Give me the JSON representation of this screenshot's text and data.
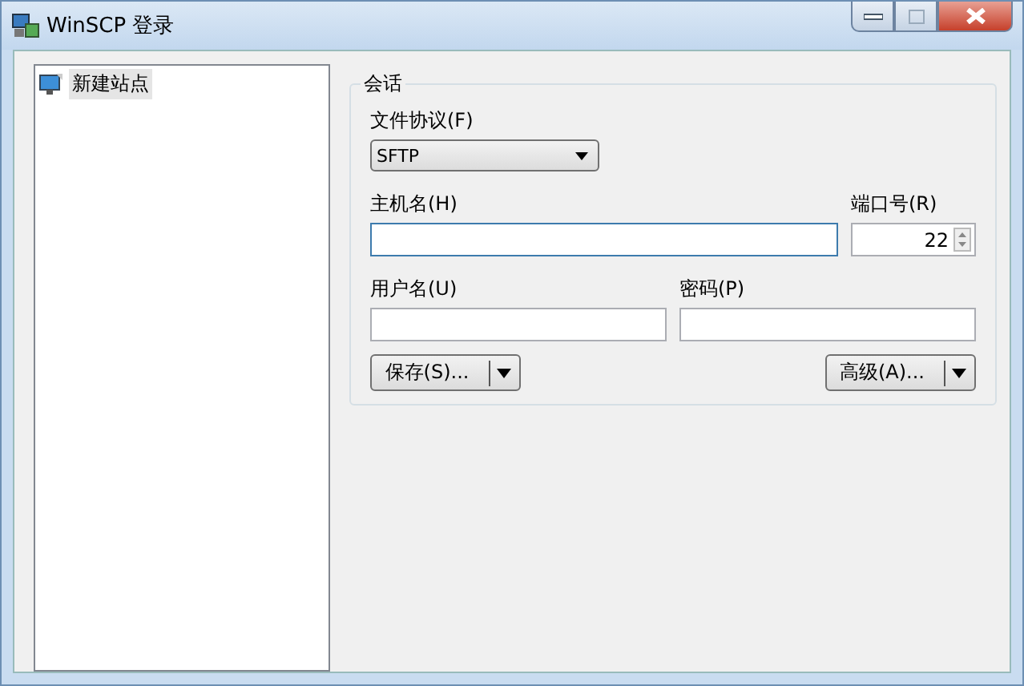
{
  "window": {
    "title": "WinSCP 登录"
  },
  "site_tree": {
    "items": [
      {
        "label": "新建站点",
        "selected": true
      }
    ]
  },
  "session": {
    "title": "会话",
    "protocol": {
      "label": "文件协议(F)",
      "value": "SFTP"
    },
    "host": {
      "label": "主机名(H)"
    },
    "port": {
      "label": "端口号(R)",
      "value": "22"
    },
    "user": {
      "label": "用户名(U)"
    },
    "password": {
      "label": "密码(P)"
    },
    "buttons": [
      {
        "label": "保存(S)..."
      },
      {
        "label": "高级(A)..."
      }
    ]
  }
}
